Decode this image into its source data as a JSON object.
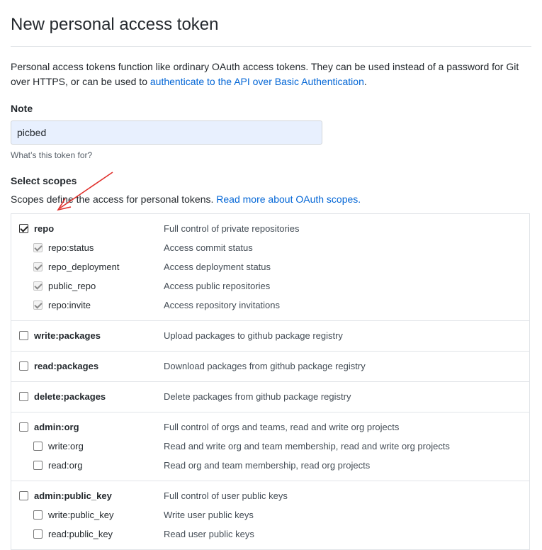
{
  "page": {
    "title": "New personal access token",
    "intro_text": "Personal access tokens function like ordinary OAuth access tokens. They can be used instead of a password for Git over HTTPS, or can be used to ",
    "intro_link": "authenticate to the API over Basic Authentication",
    "intro_end": "."
  },
  "note": {
    "label": "Note",
    "value": "picbed",
    "hint": "What’s this token for?"
  },
  "scopes": {
    "title": "Select scopes",
    "desc_text": "Scopes define the access for personal tokens. ",
    "desc_link": "Read more about OAuth scopes.",
    "groups": [
      {
        "name": "repo",
        "description": "Full control of private repositories",
        "checked": true,
        "children": [
          {
            "name": "repo:status",
            "description": "Access commit status",
            "checked": true
          },
          {
            "name": "repo_deployment",
            "description": "Access deployment status",
            "checked": true
          },
          {
            "name": "public_repo",
            "description": "Access public repositories",
            "checked": true
          },
          {
            "name": "repo:invite",
            "description": "Access repository invitations",
            "checked": true
          }
        ]
      },
      {
        "name": "write:packages",
        "description": "Upload packages to github package registry",
        "checked": false,
        "children": []
      },
      {
        "name": "read:packages",
        "description": "Download packages from github package registry",
        "checked": false,
        "children": []
      },
      {
        "name": "delete:packages",
        "description": "Delete packages from github package registry",
        "checked": false,
        "children": []
      },
      {
        "name": "admin:org",
        "description": "Full control of orgs and teams, read and write org projects",
        "checked": false,
        "children": [
          {
            "name": "write:org",
            "description": "Read and write org and team membership, read and write org projects",
            "checked": false
          },
          {
            "name": "read:org",
            "description": "Read org and team membership, read org projects",
            "checked": false
          }
        ]
      },
      {
        "name": "admin:public_key",
        "description": "Full control of user public keys",
        "checked": false,
        "children": [
          {
            "name": "write:public_key",
            "description": "Write user public keys",
            "checked": false
          },
          {
            "name": "read:public_key",
            "description": "Read user public keys",
            "checked": false
          }
        ]
      }
    ]
  },
  "colors": {
    "link": "#0366d6",
    "annotation_arrow": "#e0302c",
    "input_background": "#e8f0fe"
  }
}
